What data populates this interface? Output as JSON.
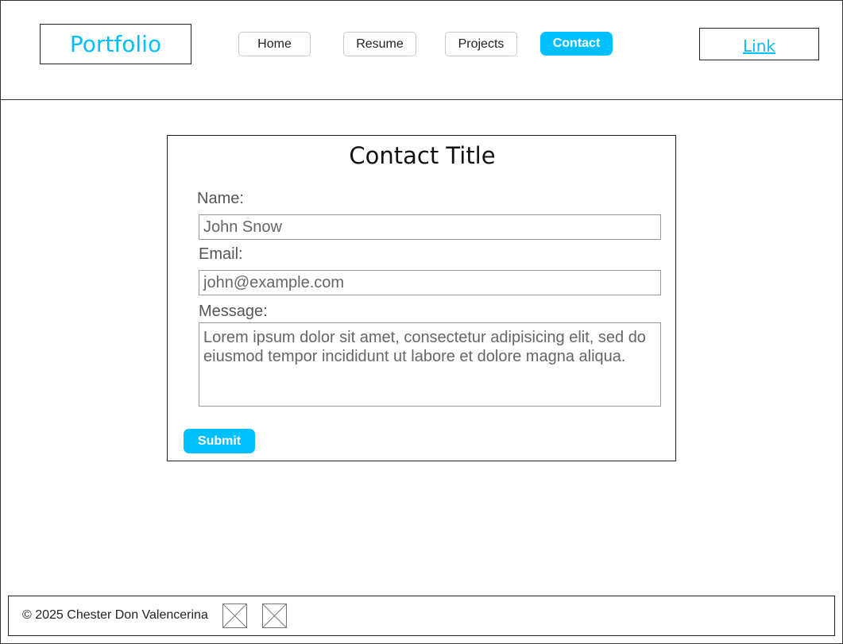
{
  "header": {
    "logo": "Portfolio",
    "nav": [
      {
        "label": "Home",
        "active": false
      },
      {
        "label": "Resume",
        "active": false
      },
      {
        "label": "Projects",
        "active": false
      },
      {
        "label": "Contact",
        "active": true
      }
    ],
    "link_label": "Link"
  },
  "form": {
    "title": "Contact Title",
    "name_label": "Name:",
    "name_value": "John Snow",
    "email_label": "Email:",
    "email_value": "john@example.com",
    "message_label": "Message:",
    "message_value": "Lorem ipsum dolor sit amet, consectetur adipisicing elit, sed do eiusmod tempor incididunt ut labore et dolore magna aliqua.",
    "submit_label": "Submit"
  },
  "footer": {
    "copyright": "© 2025 Chester Don Valencerina",
    "icons": [
      "image-placeholder-icon",
      "image-placeholder-icon"
    ]
  },
  "colors": {
    "accent": "#00bfff",
    "border": "#222222"
  }
}
